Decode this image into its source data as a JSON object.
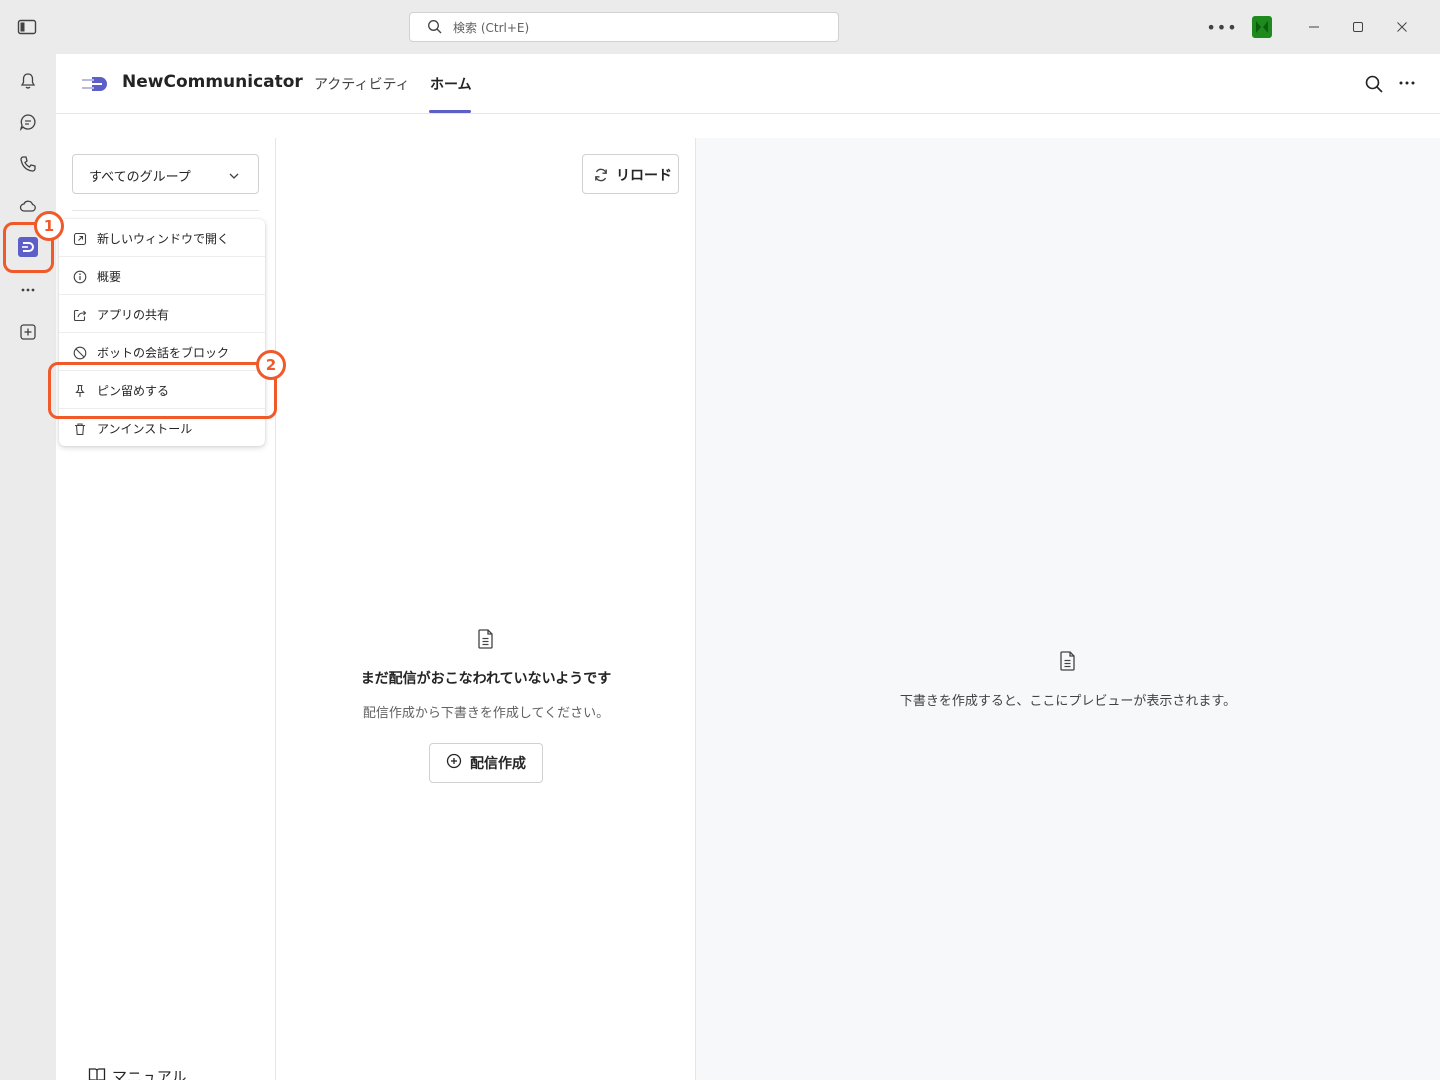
{
  "titlebar": {
    "search_placeholder": "検索 (Ctrl+E)",
    "more_label": "•••"
  },
  "app": {
    "name": "NewCommunicator",
    "tabs": [
      {
        "label": "アクティビティ",
        "active": false
      },
      {
        "label": "ホーム",
        "active": true
      }
    ],
    "accent_color": "#5b5fc7"
  },
  "left_panel": {
    "group_select_value": "すべてのグループ",
    "manual_label": "マニュアル"
  },
  "context_menu": {
    "items": [
      {
        "label": "新しいウィンドウで開く",
        "icon": "open-external-icon"
      },
      {
        "label": "概要",
        "icon": "info-icon"
      },
      {
        "label": "アプリの共有",
        "icon": "share-icon"
      },
      {
        "label": "ボットの会話をブロック",
        "icon": "block-icon"
      },
      {
        "label": "ピン留めする",
        "icon": "pin-icon"
      },
      {
        "label": "アンインストール",
        "icon": "trash-icon"
      }
    ]
  },
  "middle_panel": {
    "reload_label": "リロード",
    "empty_title": "まだ配信がおこなわれていないようです",
    "empty_subtitle": "配信作成から下書きを作成してください。",
    "create_label": "配信作成"
  },
  "right_panel": {
    "preview_text": "下書きを作成すると、ここにプレビューが表示されます。"
  },
  "annotations": [
    {
      "number": "1",
      "color": "#f0592a"
    },
    {
      "number": "2",
      "color": "#f0592a"
    }
  ]
}
